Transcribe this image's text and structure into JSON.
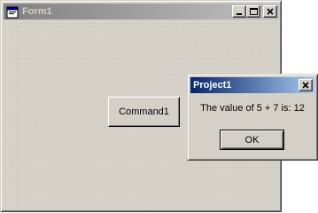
{
  "form": {
    "title": "Form1",
    "icon": "form-app-icon",
    "controls": {
      "minimize_icon": "minimize-icon",
      "maximize_icon": "maximize-icon",
      "close_icon": "close-icon"
    },
    "command_button_label": "Command1"
  },
  "message_box": {
    "title": "Project1",
    "message": "The value of 5 + 7 is: 12",
    "ok_label": "OK",
    "close_icon": "close-icon"
  },
  "colors": {
    "face": "#d4d0c8",
    "active_title_start": "#0a246a",
    "active_title_end": "#a6caf0",
    "inactive_title_start": "#808080",
    "inactive_title_end": "#c0c0c0"
  }
}
